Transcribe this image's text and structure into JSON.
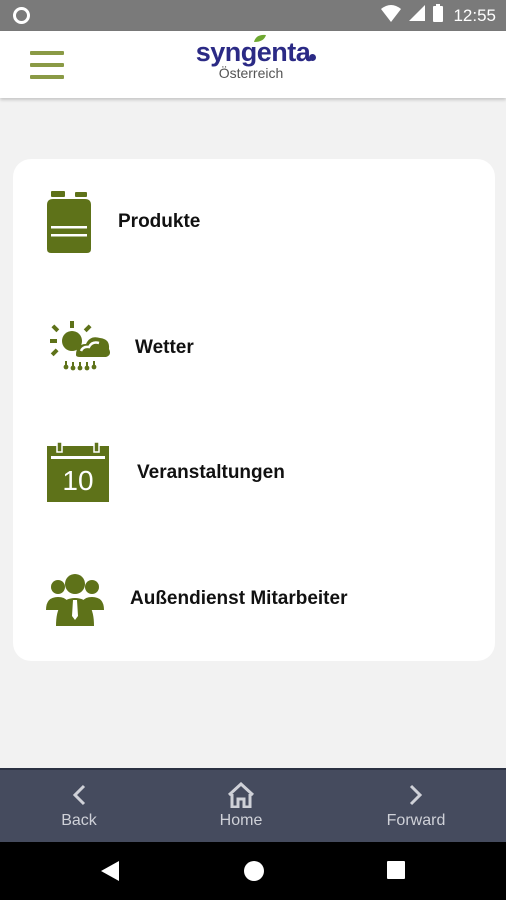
{
  "status_bar": {
    "time": "12:55",
    "icons": [
      "circle-notification-icon",
      "wifi-icon",
      "signal-icon",
      "battery-icon"
    ]
  },
  "header": {
    "menu_icon": "hamburger-menu-icon",
    "brand": "syngenta",
    "country": "Österreich"
  },
  "menu": {
    "items": [
      {
        "label": "Produkte",
        "icon": "canister-icon"
      },
      {
        "label": "Wetter",
        "icon": "weather-icon"
      },
      {
        "label": "Veranstaltungen",
        "icon": "calendar-icon",
        "icon_text": "10"
      },
      {
        "label": "Außendienst Mitarbeiter",
        "icon": "team-icon"
      }
    ]
  },
  "bottom_nav": {
    "back": "Back",
    "home": "Home",
    "forward": "Forward"
  },
  "colors": {
    "accent_green": "#5e7219",
    "menu_green": "#8a9a45",
    "brand_blue": "#2b2a85",
    "nav_bg": "#454b5e"
  }
}
